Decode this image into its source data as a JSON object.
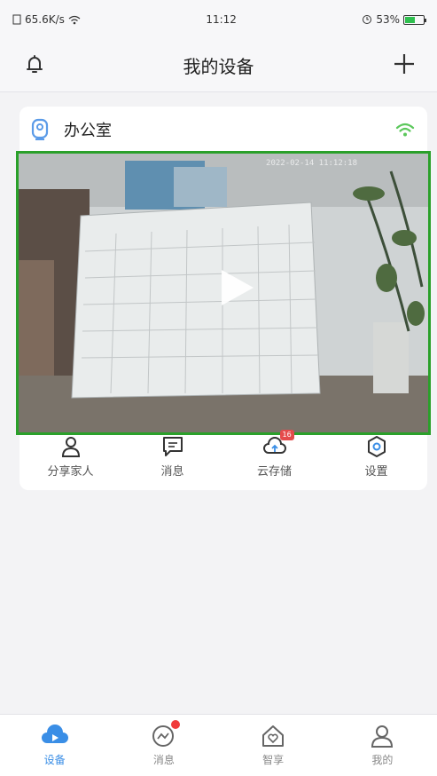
{
  "status_bar": {
    "network_speed": "65.6K/s",
    "time": "11:12",
    "battery_percent": "53%",
    "battery_level": 0.53
  },
  "nav": {
    "title": "我的设备"
  },
  "device": {
    "name": "办公室",
    "timestamp": "2022-02-14 11:12:18",
    "actions": [
      {
        "label": "分享家人",
        "icon": "share-family-icon"
      },
      {
        "label": "消息",
        "icon": "message-icon"
      },
      {
        "label": "云存储",
        "icon": "cloud-storage-icon",
        "badge": "16"
      },
      {
        "label": "设置",
        "icon": "settings-icon"
      }
    ]
  },
  "tabs": [
    {
      "label": "设备",
      "icon": "device-tab-icon",
      "active": true
    },
    {
      "label": "消息",
      "icon": "message-tab-icon",
      "dot": true
    },
    {
      "label": "智享",
      "icon": "smart-share-tab-icon"
    },
    {
      "label": "我的",
      "icon": "profile-tab-icon"
    }
  ],
  "colors": {
    "accent": "#3a8ee6",
    "frame_border": "#2aa02a",
    "wifi": "#5cc85c",
    "badge": "#e54b4b"
  }
}
